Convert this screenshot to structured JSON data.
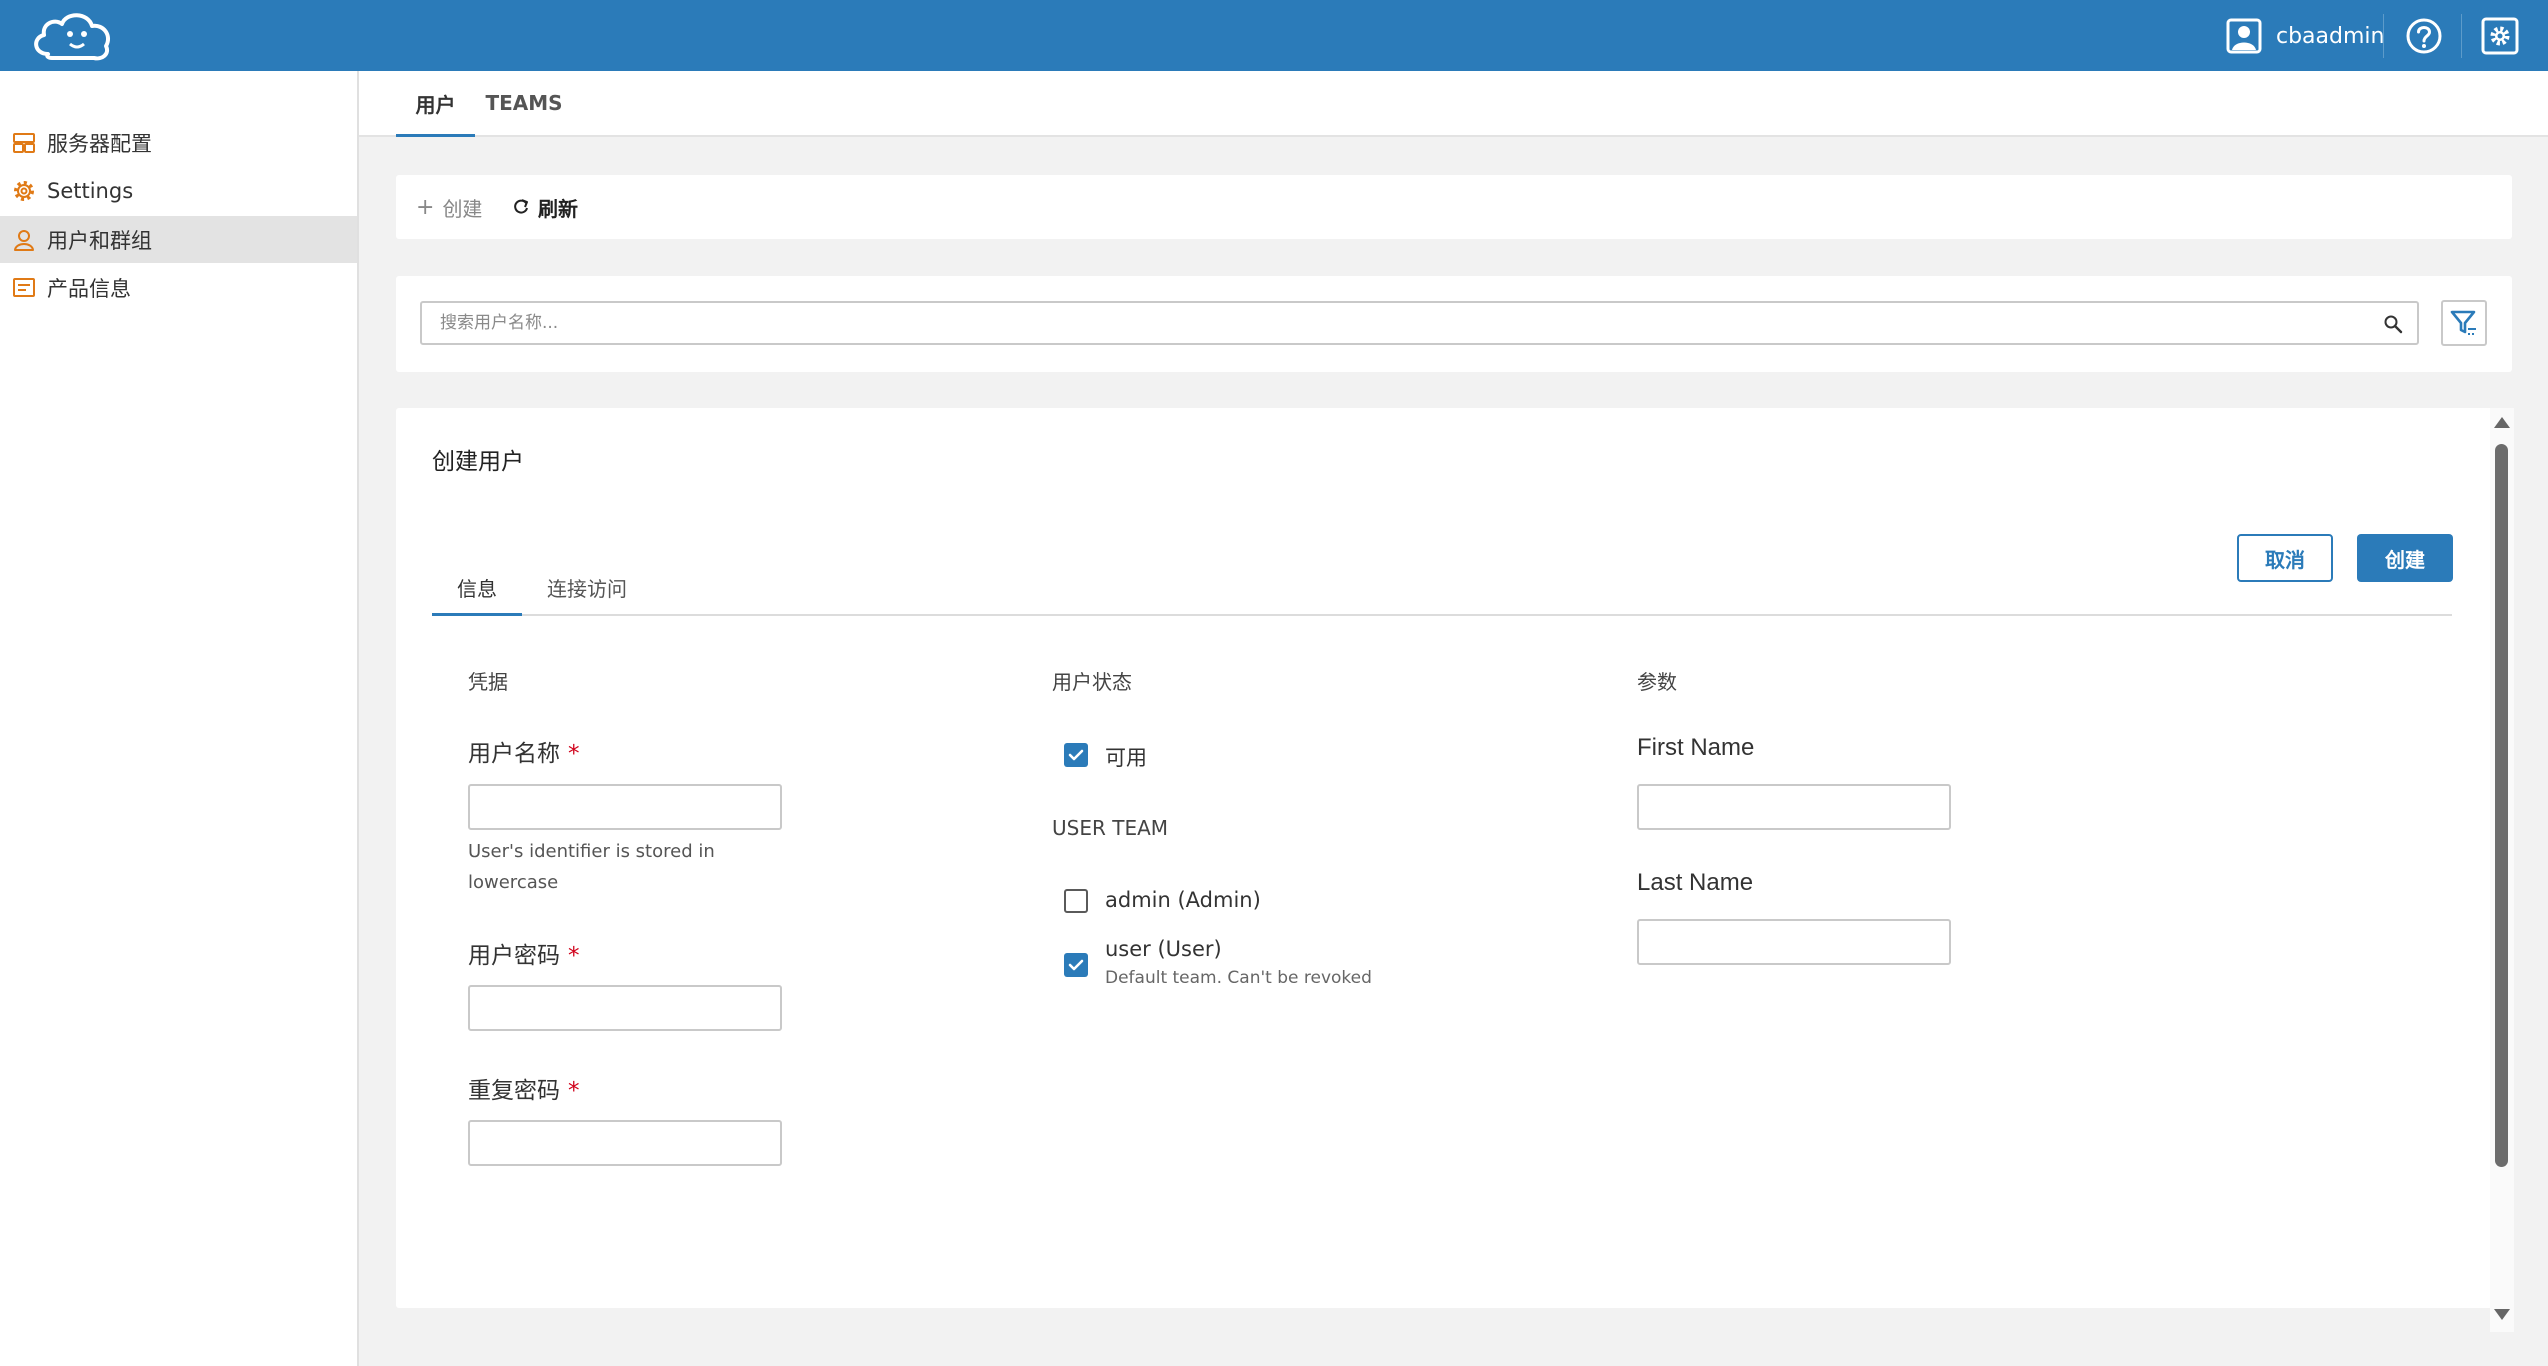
{
  "header": {
    "username": "cbaadmin",
    "icons": {
      "logo": "cloud-mascot-logo",
      "user": "user-avatar-icon",
      "help": "help-icon",
      "settings": "settings-icon"
    },
    "colors": {
      "bar": "#2b7bb9",
      "accent": "#e07a16"
    }
  },
  "sidebar": {
    "items": [
      {
        "label": "服务器配置",
        "icon": "server-config-icon"
      },
      {
        "label": "Settings",
        "icon": "gear-icon"
      },
      {
        "label": "用户和群组",
        "icon": "user-icon",
        "active": true
      },
      {
        "label": "产品信息",
        "icon": "product-info-icon"
      }
    ]
  },
  "main_tabs": [
    {
      "label": "用户",
      "active": true
    },
    {
      "label": "TEAMS"
    }
  ],
  "actions": {
    "create_label": "创建",
    "refresh_label": "刷新"
  },
  "search": {
    "placeholder": "搜索用户名称..."
  },
  "form": {
    "title": "创建用户",
    "tabs": [
      {
        "label": "信息",
        "active": true
      },
      {
        "label": "连接访问"
      }
    ],
    "cancel_label": "取消",
    "create_label": "创建",
    "credentials": {
      "heading": "凭据",
      "username_label": "用户名称",
      "username_hint": "User's identifier is stored in lowercase",
      "password_label": "用户密码",
      "repeat_password_label": "重复密码",
      "required_mark": "*"
    },
    "status": {
      "heading": "用户状态",
      "enabled_label": "可用",
      "enabled_checked": true,
      "team_heading": "USER TEAM",
      "teams": [
        {
          "label": "admin (Admin)",
          "checked": false,
          "sub": ""
        },
        {
          "label": "user (User)",
          "checked": true,
          "sub": "Default team. Can't be revoked"
        }
      ]
    },
    "params": {
      "heading": "参数",
      "first_name_label": "First Name",
      "last_name_label": "Last Name"
    }
  }
}
